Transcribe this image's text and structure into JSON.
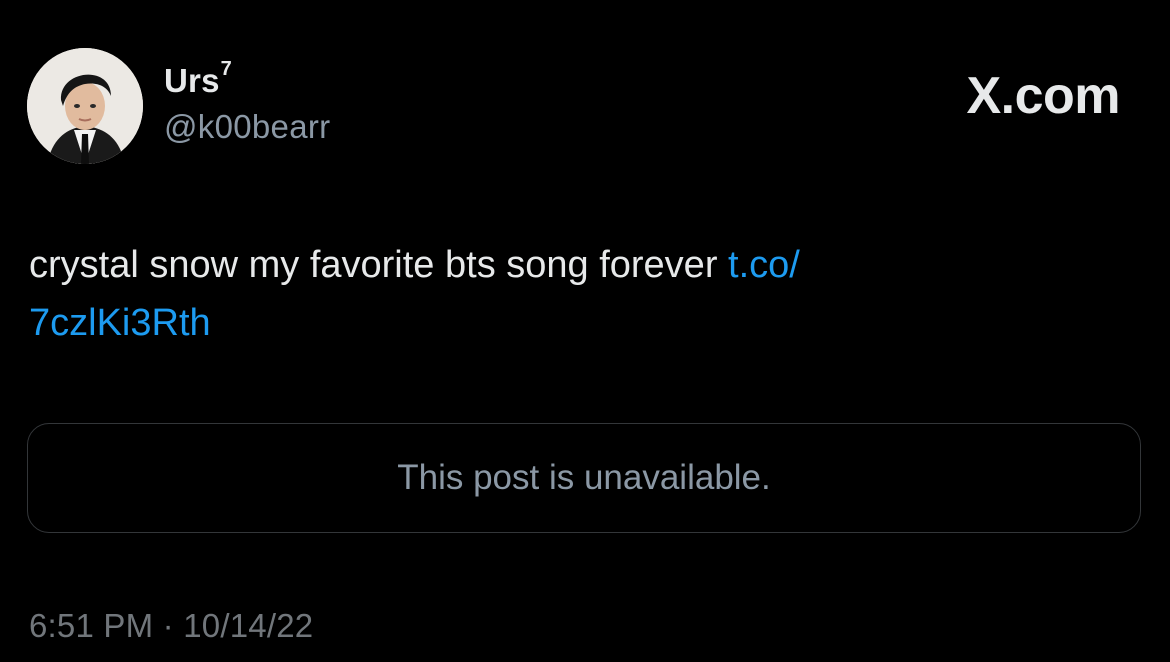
{
  "author": {
    "name": "Urs",
    "name_sup": "7",
    "handle": "@k00bearr"
  },
  "brand": "X.com",
  "tweet": {
    "text": "crystal snow my favorite bts song forever ",
    "link_part1": "t.co/",
    "link_part2": "7czlKi3Rth"
  },
  "quote_card": {
    "message": "This post is unavailable."
  },
  "timestamp": {
    "time": "6:51 PM",
    "separator": "·",
    "date": "10/14/22"
  },
  "colors": {
    "background": "#000000",
    "text": "#e7e9ea",
    "link": "#1d9bf0",
    "muted": "#71767b"
  }
}
